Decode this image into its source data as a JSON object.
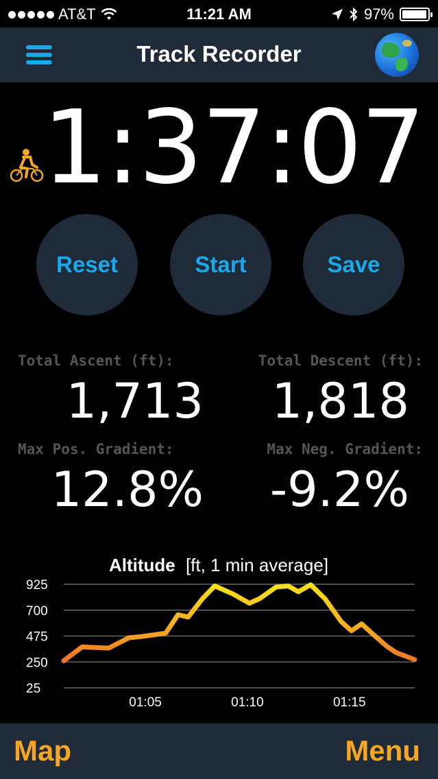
{
  "status_bar": {
    "carrier": "AT&T",
    "time": "11:21 AM",
    "battery": "97%",
    "battery_level": 0.97
  },
  "nav": {
    "title": "Track Recorder"
  },
  "timer": {
    "elapsed": "1:37:07",
    "activity": "bike-icon"
  },
  "buttons": {
    "reset": "Reset",
    "start": "Start",
    "save": "Save"
  },
  "stats": {
    "total_ascent_label": "Total Ascent (ft):",
    "total_ascent": "1,713",
    "total_descent_label": "Total Descent (ft):",
    "total_descent": "1,818",
    "max_pos_gradient_label": "Max Pos. Gradient:",
    "max_pos_gradient": "12.8%",
    "max_neg_gradient_label": "Max Neg. Gradient:",
    "max_neg_gradient": "-9.2%"
  },
  "chart_data": {
    "type": "line",
    "title": "Altitude",
    "subtitle": "[ft, 1 min average]",
    "ylim": [
      25,
      925
    ],
    "yticks": [
      925,
      700,
      475,
      250,
      25
    ],
    "xlim": [
      61.0,
      78.2
    ],
    "xticks": [
      {
        "value": 65,
        "label": "01:05"
      },
      {
        "value": 70,
        "label": "01:10"
      },
      {
        "value": 75,
        "label": "01:15"
      }
    ],
    "grid": true,
    "x": [
      61.0,
      61.9,
      63.2,
      64.2,
      64.8,
      66.0,
      66.6,
      67.1,
      67.8,
      68.4,
      69.3,
      70.1,
      70.6,
      71.4,
      72.0,
      72.5,
      73.1,
      73.8,
      74.6,
      75.1,
      75.6,
      76.1,
      76.8,
      77.3,
      78.2
    ],
    "values": [
      260,
      380,
      370,
      460,
      470,
      500,
      660,
      640,
      800,
      910,
      840,
      760,
      800,
      900,
      910,
      860,
      920,
      800,
      600,
      520,
      580,
      500,
      390,
      330,
      270
    ],
    "colors": {
      "low": "#e8482a",
      "mid": "#f5a623",
      "high": "#f5e21a"
    }
  },
  "bottom_bar": {
    "map": "Map",
    "menu": "Menu"
  },
  "colors": {
    "accent_blue": "#1aa8e8",
    "accent_orange": "#f5a623",
    "bar_background": "#1f2b38"
  }
}
